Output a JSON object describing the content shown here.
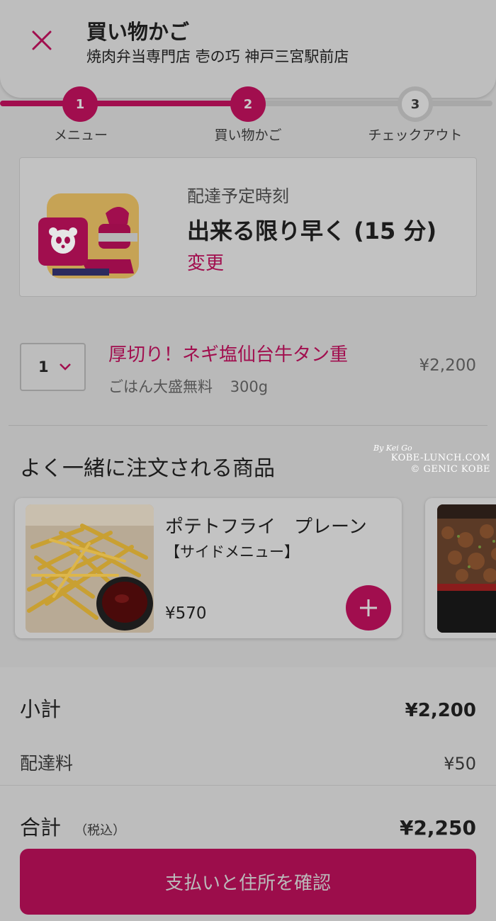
{
  "header": {
    "title": "買い物かご",
    "subtitle": "焼肉弁当専門店 壱の巧  神戸三宮駅前店",
    "close_icon": "close-icon"
  },
  "stepper": {
    "steps": [
      {
        "number": "1",
        "label": "メニュー",
        "state": "done"
      },
      {
        "number": "2",
        "label": "買い物かご",
        "state": "active"
      },
      {
        "number": "3",
        "label": "チェックアウト",
        "state": "pending"
      }
    ]
  },
  "delivery": {
    "label": "配達予定時刻",
    "time": "出来る限り早く (15 分)",
    "change": "変更"
  },
  "cart_item": {
    "quantity": "1",
    "name": "厚切り！ネギ塩仙台牛タン重",
    "option": "ごはん大盛無料",
    "weight": "300g",
    "price": "¥2,200"
  },
  "recommendations": {
    "title": "よく一緒に注文される商品",
    "items": [
      {
        "name": "ポテトフライ　プレーン",
        "category": "【サイドメニュー】",
        "price": "¥570"
      }
    ]
  },
  "watermark": {
    "signature": "By Kei Go",
    "line1": "KOBE-LUNCH.COM",
    "line2": "© GENIC KOBE"
  },
  "totals": {
    "subtotal_label": "小計",
    "subtotal_value": "¥2,200",
    "fee_label": "配達料",
    "fee_value": "¥50",
    "total_label": "合計",
    "total_note": "（税込）",
    "total_value": "¥2,250"
  },
  "checkout_button": "支払いと住所を確認",
  "colors": {
    "accent": "#a10e4e",
    "background": "#bdbdbd",
    "inactive": "#a9a9a9"
  }
}
